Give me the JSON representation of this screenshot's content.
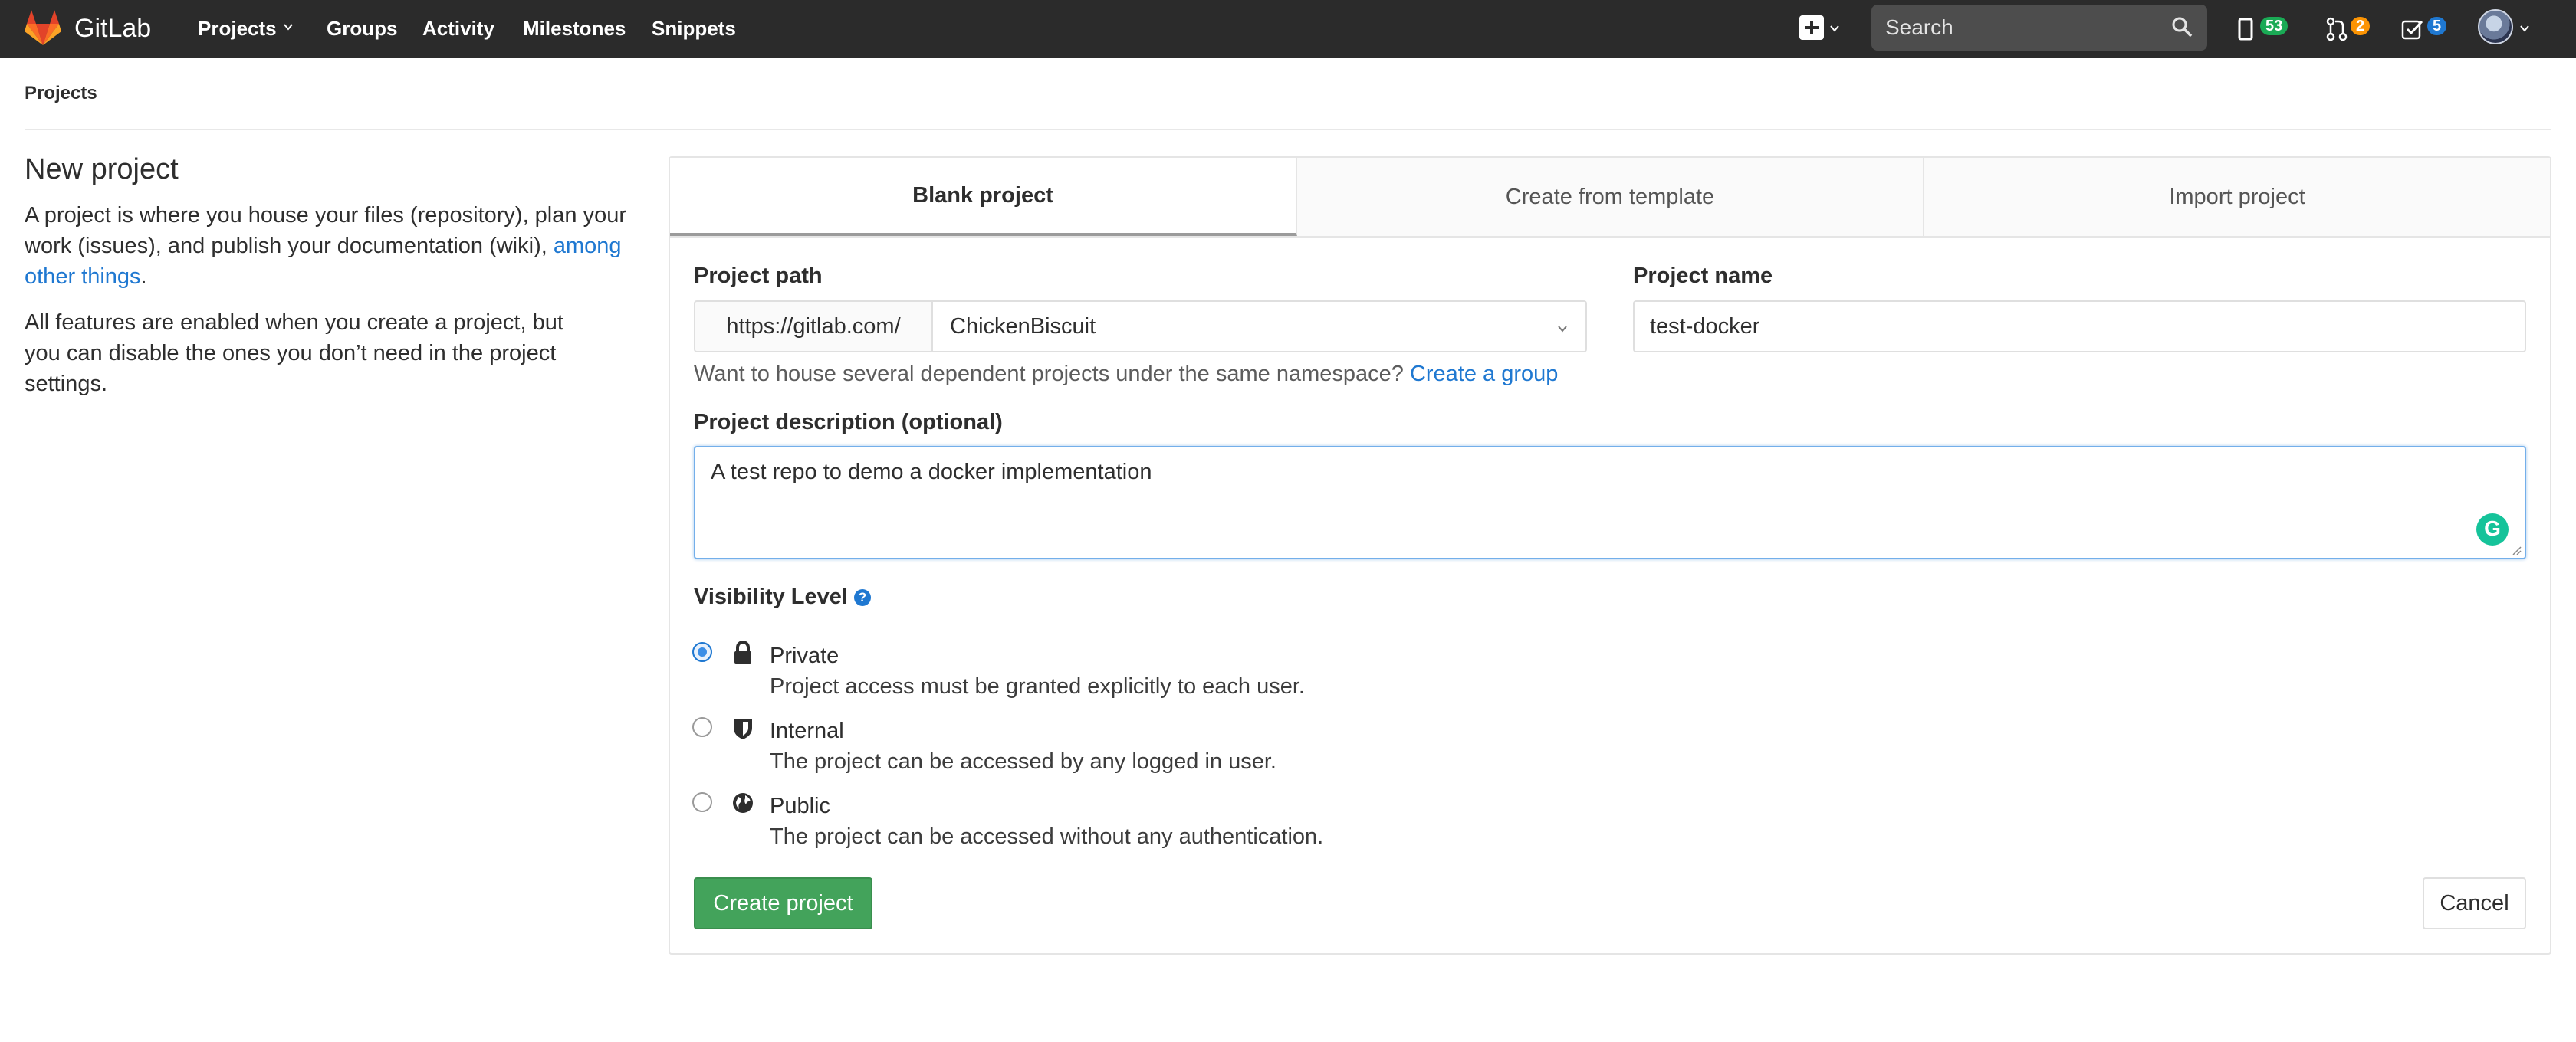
{
  "nav": {
    "brand": "GitLab",
    "links": [
      "Projects",
      "Groups",
      "Activity",
      "Milestones",
      "Snippets"
    ],
    "search_placeholder": "Search",
    "issues_count": "53",
    "merge_requests_count": "2",
    "todos_count": "5",
    "colors": {
      "issues": "#1aaa55",
      "merge_requests": "#fc9403",
      "todos": "#1f78d1"
    }
  },
  "breadcrumb": "Projects",
  "left": {
    "title": "New project",
    "intro_text": "A project is where you house your files (repository), plan your work (issues), and publish your documentation (wiki),",
    "intro_link": "among other things",
    "intro_end": ".",
    "features_text": "All features are enabled when you create a project, but you can disable the ones you don’t need in the project settings."
  },
  "tabs": [
    "Blank project",
    "Create from template",
    "Import project"
  ],
  "form": {
    "path_label": "Project path",
    "path_prefix": "https://gitlab.com/",
    "namespace": "ChickenBiscuit",
    "name_label": "Project name",
    "name_value": "test-docker",
    "namespace_help": "Want to house several dependent projects under the same namespace?",
    "namespace_help_link": "Create a group",
    "description_label": "Project description (optional)",
    "description_value": "A test repo to demo a docker implementation",
    "visibility_label": "Visibility Level",
    "visibility_options": [
      {
        "title": "Private",
        "description": "Project access must be granted explicitly to each user.",
        "icon": "lock-icon",
        "checked": true
      },
      {
        "title": "Internal",
        "description": "The project can be accessed by any logged in user.",
        "icon": "shield-icon",
        "checked": false
      },
      {
        "title": "Public",
        "description": "The project can be accessed without any authentication.",
        "icon": "globe-icon",
        "checked": false
      }
    ],
    "create_button": "Create project",
    "cancel_button": "Cancel"
  }
}
